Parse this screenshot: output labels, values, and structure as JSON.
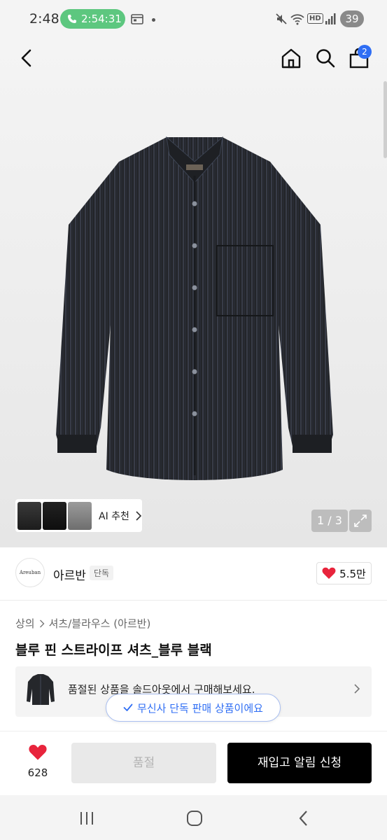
{
  "status_bar": {
    "time": "2:48",
    "call_timer": "2:54:31",
    "network_badge": "HD",
    "battery": "39"
  },
  "top_nav": {
    "cart_count": "2",
    "icons": [
      "chevron-left-icon",
      "home-icon",
      "search-icon",
      "shopping-bag-icon"
    ]
  },
  "gallery": {
    "ai_label": "AI 추천",
    "page_indicator": "1 / 3"
  },
  "brand": {
    "logo_text": "Areuban",
    "name": "아르반",
    "badge": "단독",
    "likes": "5.5만"
  },
  "product": {
    "breadcrumb": [
      "상의",
      "셔츠/블라우스 (아르반)"
    ],
    "title": "블루 핀 스트라이프 셔츠_블루 블랙",
    "soldout_notice": "품절된 상품을 솔드아웃에서 구매해보세요.",
    "exclusive_toast": "무신사 단독 판매 상품이에요"
  },
  "action_bar": {
    "wish_count": "628",
    "soldout_label": "품절",
    "restock_label": "재입고 알림 신청"
  },
  "colors": {
    "accent_blue": "#2f6ef4",
    "heart_red": "#e8243c",
    "call_green": "#5dc77f",
    "primary_black": "#000000"
  }
}
